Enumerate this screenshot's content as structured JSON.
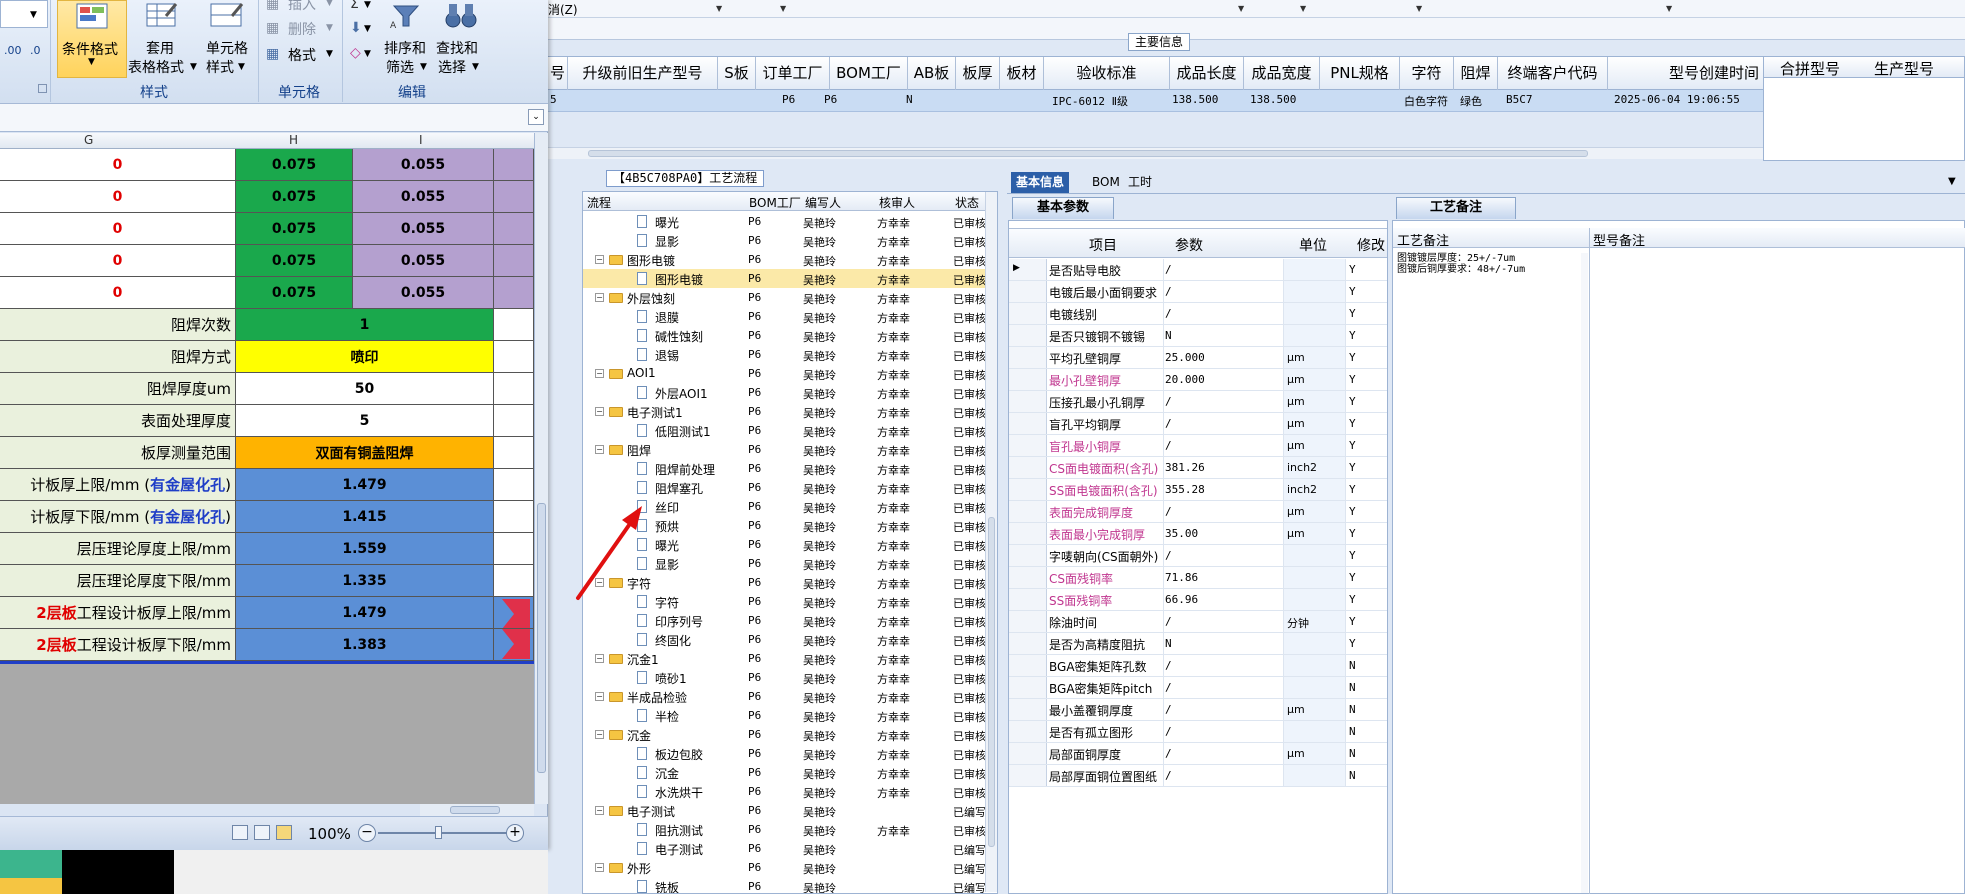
{
  "menu": {
    "cancel": "消(Z)"
  },
  "main_info_tab": "主要信息",
  "grid": {
    "headers": [
      "号",
      "升级前旧生产型号",
      "S板",
      "订单工厂",
      "BOM工厂",
      "AB板",
      "板厚",
      "板材",
      "验收标准",
      "成品长度",
      "成品宽度",
      "PNL规格",
      "字符",
      "阻焊",
      "终端客户代码",
      "型号创建时间"
    ],
    "row": {
      "c0": "5",
      "order_factory": "P6",
      "bom_factory": "P6",
      "ab": "N",
      "standard": "IPC-6012 Ⅱ级",
      "length": "138.500",
      "width": "138.500",
      "char": "白色字符",
      "mask": "绿色",
      "customer": "B5C7",
      "created": "2025-06-04 19:06:55"
    },
    "merge_headers": [
      "合拼型号",
      "生产型号"
    ]
  },
  "flow": {
    "title": "【4B5C708PA0】工艺流程",
    "headers": [
      "流程",
      "BOM工厂",
      "编写人",
      "核审人",
      "状态"
    ],
    "rows": [
      {
        "name": "曝光",
        "level": 2,
        "folder": false,
        "bom": "P6",
        "writer": "吴艳玲",
        "reviewer": "方幸幸",
        "status": "已审核"
      },
      {
        "name": "显影",
        "level": 2,
        "folder": false,
        "bom": "P6",
        "writer": "吴艳玲",
        "reviewer": "方幸幸",
        "status": "已审核"
      },
      {
        "name": "图形电镀",
        "level": 1,
        "folder": true,
        "bom": "P6",
        "writer": "吴艳玲",
        "reviewer": "方幸幸",
        "status": "已审核"
      },
      {
        "name": "图形电镀",
        "level": 2,
        "folder": false,
        "bom": "P6",
        "writer": "吴艳玲",
        "reviewer": "方幸幸",
        "status": "已审核",
        "selected": true
      },
      {
        "name": "外层蚀刻",
        "level": 1,
        "folder": true,
        "bom": "P6",
        "writer": "吴艳玲",
        "reviewer": "方幸幸",
        "status": "已审核"
      },
      {
        "name": "退膜",
        "level": 2,
        "folder": false,
        "bom": "P6",
        "writer": "吴艳玲",
        "reviewer": "方幸幸",
        "status": "已审核"
      },
      {
        "name": "碱性蚀刻",
        "level": 2,
        "folder": false,
        "bom": "P6",
        "writer": "吴艳玲",
        "reviewer": "方幸幸",
        "status": "已审核"
      },
      {
        "name": "退锡",
        "level": 2,
        "folder": false,
        "bom": "P6",
        "writer": "吴艳玲",
        "reviewer": "方幸幸",
        "status": "已审核"
      },
      {
        "name": "AOI1",
        "level": 1,
        "folder": true,
        "bom": "P6",
        "writer": "吴艳玲",
        "reviewer": "方幸幸",
        "status": "已审核"
      },
      {
        "name": "外层AOI1",
        "level": 2,
        "folder": false,
        "bom": "P6",
        "writer": "吴艳玲",
        "reviewer": "方幸幸",
        "status": "已审核"
      },
      {
        "name": "电子测试1",
        "level": 1,
        "folder": true,
        "bom": "P6",
        "writer": "吴艳玲",
        "reviewer": "方幸幸",
        "status": "已审核"
      },
      {
        "name": "低阻测试1",
        "level": 2,
        "folder": false,
        "bom": "P6",
        "writer": "吴艳玲",
        "reviewer": "方幸幸",
        "status": "已审核"
      },
      {
        "name": "阻焊",
        "level": 1,
        "folder": true,
        "bom": "P6",
        "writer": "吴艳玲",
        "reviewer": "方幸幸",
        "status": "已审核"
      },
      {
        "name": "阻焊前处理",
        "level": 2,
        "folder": false,
        "bom": "P6",
        "writer": "吴艳玲",
        "reviewer": "方幸幸",
        "status": "已审核"
      },
      {
        "name": "阻焊塞孔",
        "level": 2,
        "folder": false,
        "bom": "P6",
        "writer": "吴艳玲",
        "reviewer": "方幸幸",
        "status": "已审核"
      },
      {
        "name": "丝印",
        "level": 2,
        "folder": false,
        "bom": "P6",
        "writer": "吴艳玲",
        "reviewer": "方幸幸",
        "status": "已审核"
      },
      {
        "name": "预烘",
        "level": 2,
        "folder": false,
        "bom": "P6",
        "writer": "吴艳玲",
        "reviewer": "方幸幸",
        "status": "已审核"
      },
      {
        "name": "曝光",
        "level": 2,
        "folder": false,
        "bom": "P6",
        "writer": "吴艳玲",
        "reviewer": "方幸幸",
        "status": "已审核"
      },
      {
        "name": "显影",
        "level": 2,
        "folder": false,
        "bom": "P6",
        "writer": "吴艳玲",
        "reviewer": "方幸幸",
        "status": "已审核"
      },
      {
        "name": "字符",
        "level": 1,
        "folder": true,
        "bom": "P6",
        "writer": "吴艳玲",
        "reviewer": "方幸幸",
        "status": "已审核"
      },
      {
        "name": "字符",
        "level": 2,
        "folder": false,
        "bom": "P6",
        "writer": "吴艳玲",
        "reviewer": "方幸幸",
        "status": "已审核"
      },
      {
        "name": "印序列号",
        "level": 2,
        "folder": false,
        "bom": "P6",
        "writer": "吴艳玲",
        "reviewer": "方幸幸",
        "status": "已审核"
      },
      {
        "name": "终固化",
        "level": 2,
        "folder": false,
        "bom": "P6",
        "writer": "吴艳玲",
        "reviewer": "方幸幸",
        "status": "已审核"
      },
      {
        "name": "沉金1",
        "level": 1,
        "folder": true,
        "bom": "P6",
        "writer": "吴艳玲",
        "reviewer": "方幸幸",
        "status": "已审核"
      },
      {
        "name": "喷砂1",
        "level": 2,
        "folder": false,
        "bom": "P6",
        "writer": "吴艳玲",
        "reviewer": "方幸幸",
        "status": "已审核"
      },
      {
        "name": "半成品检验",
        "level": 1,
        "folder": true,
        "bom": "P6",
        "writer": "吴艳玲",
        "reviewer": "方幸幸",
        "status": "已审核"
      },
      {
        "name": "半检",
        "level": 2,
        "folder": false,
        "bom": "P6",
        "writer": "吴艳玲",
        "reviewer": "方幸幸",
        "status": "已审核"
      },
      {
        "name": "沉金",
        "level": 1,
        "folder": true,
        "bom": "P6",
        "writer": "吴艳玲",
        "reviewer": "方幸幸",
        "status": "已审核"
      },
      {
        "name": "板边包胶",
        "level": 2,
        "folder": false,
        "bom": "P6",
        "writer": "吴艳玲",
        "reviewer": "方幸幸",
        "status": "已审核"
      },
      {
        "name": "沉金",
        "level": 2,
        "folder": false,
        "bom": "P6",
        "writer": "吴艳玲",
        "reviewer": "方幸幸",
        "status": "已审核"
      },
      {
        "name": "水洗烘干",
        "level": 2,
        "folder": false,
        "bom": "P6",
        "writer": "吴艳玲",
        "reviewer": "方幸幸",
        "status": "已审核"
      },
      {
        "name": "电子测试",
        "level": 1,
        "folder": true,
        "bom": "P6",
        "writer": "吴艳玲",
        "reviewer": "",
        "status": "已编写"
      },
      {
        "name": "阻抗测试",
        "level": 2,
        "folder": false,
        "bom": "P6",
        "writer": "吴艳玲",
        "reviewer": "方幸幸",
        "status": "已审核"
      },
      {
        "name": "电子测试",
        "level": 2,
        "folder": false,
        "bom": "P6",
        "writer": "吴艳玲",
        "reviewer": "",
        "status": "已编写"
      },
      {
        "name": "外形",
        "level": 1,
        "folder": true,
        "bom": "P6",
        "writer": "吴艳玲",
        "reviewer": "",
        "status": "已编写"
      },
      {
        "name": "铣板",
        "level": 2,
        "folder": false,
        "bom": "P6",
        "writer": "吴艳玲",
        "reviewer": "",
        "status": "已编写"
      }
    ]
  },
  "info_tabs": [
    "基本信息",
    "BOM",
    "工时"
  ],
  "params": {
    "subtab": "基本参数",
    "headers": [
      "项目",
      "参数",
      "单位",
      "修改"
    ],
    "rows": [
      {
        "item": "是否贴导电胶",
        "val": "/",
        "unit": "",
        "mod": "Y"
      },
      {
        "item": "电镀后最小面铜要求",
        "val": "/",
        "unit": "",
        "mod": "Y"
      },
      {
        "item": "电镀线别",
        "val": "/",
        "unit": "",
        "mod": "Y"
      },
      {
        "item": "是否只镀铜不镀锡",
        "val": "N",
        "unit": "",
        "mod": "Y"
      },
      {
        "item": "平均孔壁铜厚",
        "val": "25.000",
        "unit": "μm",
        "mod": "Y"
      },
      {
        "item": "最小孔壁铜厚",
        "val": "20.000",
        "unit": "μm",
        "mod": "Y",
        "pink": true
      },
      {
        "item": "压接孔最小孔铜厚",
        "val": "/",
        "unit": "μm",
        "mod": "Y"
      },
      {
        "item": "盲孔平均铜厚",
        "val": "/",
        "unit": "μm",
        "mod": "Y"
      },
      {
        "item": "盲孔最小铜厚",
        "val": "/",
        "unit": "μm",
        "mod": "Y",
        "pink": true
      },
      {
        "item": "CS面电镀面积(含孔)",
        "val": "381.26",
        "unit": "inch2",
        "mod": "Y",
        "pink": true
      },
      {
        "item": "SS面电镀面积(含孔)",
        "val": "355.28",
        "unit": "inch2",
        "mod": "Y",
        "pink": true
      },
      {
        "item": "表面完成铜厚度",
        "val": "/",
        "unit": "μm",
        "mod": "Y",
        "pink": true
      },
      {
        "item": "表面最小完成铜厚",
        "val": "35.00",
        "unit": "μm",
        "mod": "Y",
        "pink": true
      },
      {
        "item": "字唛朝向(CS面朝外)",
        "val": "/",
        "unit": "",
        "mod": "Y"
      },
      {
        "item": "CS面残铜率",
        "val": "71.86",
        "unit": "",
        "mod": "Y",
        "pink": true
      },
      {
        "item": "SS面残铜率",
        "val": "66.96",
        "unit": "",
        "mod": "Y",
        "pink": true
      },
      {
        "item": "除油时间",
        "val": "/",
        "unit": "分钟",
        "mod": "Y"
      },
      {
        "item": "是否为高精度阻抗",
        "val": "N",
        "unit": "",
        "mod": "Y"
      },
      {
        "item": "BGA密集矩阵孔数",
        "val": "/",
        "unit": "",
        "mod": "N"
      },
      {
        "item": "BGA密集矩阵pitch",
        "val": "/",
        "unit": "",
        "mod": "N"
      },
      {
        "item": "最小盖覆铜厚度",
        "val": "/",
        "unit": "μm",
        "mod": "N"
      },
      {
        "item": "是否有孤立图形",
        "val": "/",
        "unit": "",
        "mod": "N"
      },
      {
        "item": "局部面铜厚度",
        "val": "/",
        "unit": "μm",
        "mod": "N"
      },
      {
        "item": "局部厚面铜位置图纸",
        "val": "/",
        "unit": "",
        "mod": "N"
      }
    ]
  },
  "notes": {
    "subtab": "工艺备注",
    "headers": [
      "工艺备注",
      "型号备注"
    ],
    "lines": [
      "图镀镀层厚度：25+/-7um",
      "图镀后铜厚要求：48+/-7um"
    ]
  },
  "excel": {
    "ribbon": {
      "cond_format": "条件格式",
      "table_format_1": "套用",
      "table_format_2": "表格格式",
      "cell_style_1": "单元格",
      "cell_style_2": "样式",
      "insert": "插入",
      "delete": "删除",
      "format": "格式",
      "sort_1": "排序和",
      "sort_2": "筛选",
      "find_1": "查找和",
      "find_2": "选择",
      "group_style": "样式",
      "group_cells": "单元格",
      "group_edit": "编辑"
    },
    "col_headers": [
      "G",
      "H",
      "I"
    ],
    "zero_rows": [
      {
        "g": "0",
        "h": "0.075",
        "i": "0.055"
      },
      {
        "g": "0",
        "h": "0.075",
        "i": "0.055"
      },
      {
        "g": "0",
        "h": "0.075",
        "i": "0.055"
      },
      {
        "g": "0",
        "h": "0.075",
        "i": "0.055"
      },
      {
        "g": "0",
        "h": "0.075",
        "i": "0.055"
      }
    ],
    "rows": [
      {
        "label": "阻焊次数",
        "value": "1"
      },
      {
        "label": "阻焊方式",
        "value": "喷印"
      },
      {
        "label": "阻焊厚度um",
        "value": "50"
      },
      {
        "label": "表面处理厚度",
        "value": "5"
      },
      {
        "label": "板厚测量范围",
        "value": "双面有铜盖阻焊"
      },
      {
        "label_pre": "计板厚上限/mm (",
        "label_em": "有金屋化孔",
        "label_post": ")",
        "value": "1.479"
      },
      {
        "label_pre": "计板厚下限/mm (",
        "label_em": "有金屋化孔",
        "label_post": ")",
        "value": "1.415"
      },
      {
        "label": "层压理论厚度上限/mm",
        "value": "1.559"
      },
      {
        "label": "层压理论厚度下限/mm",
        "value": "1.335"
      },
      {
        "label_red": "2层板",
        "label_post": "工程设计板厚上限/mm",
        "value": "1.479"
      },
      {
        "label_red": "2层板",
        "label_post": "工程设计板厚下限/mm",
        "value": "1.383"
      }
    ],
    "zoom": "100%"
  }
}
